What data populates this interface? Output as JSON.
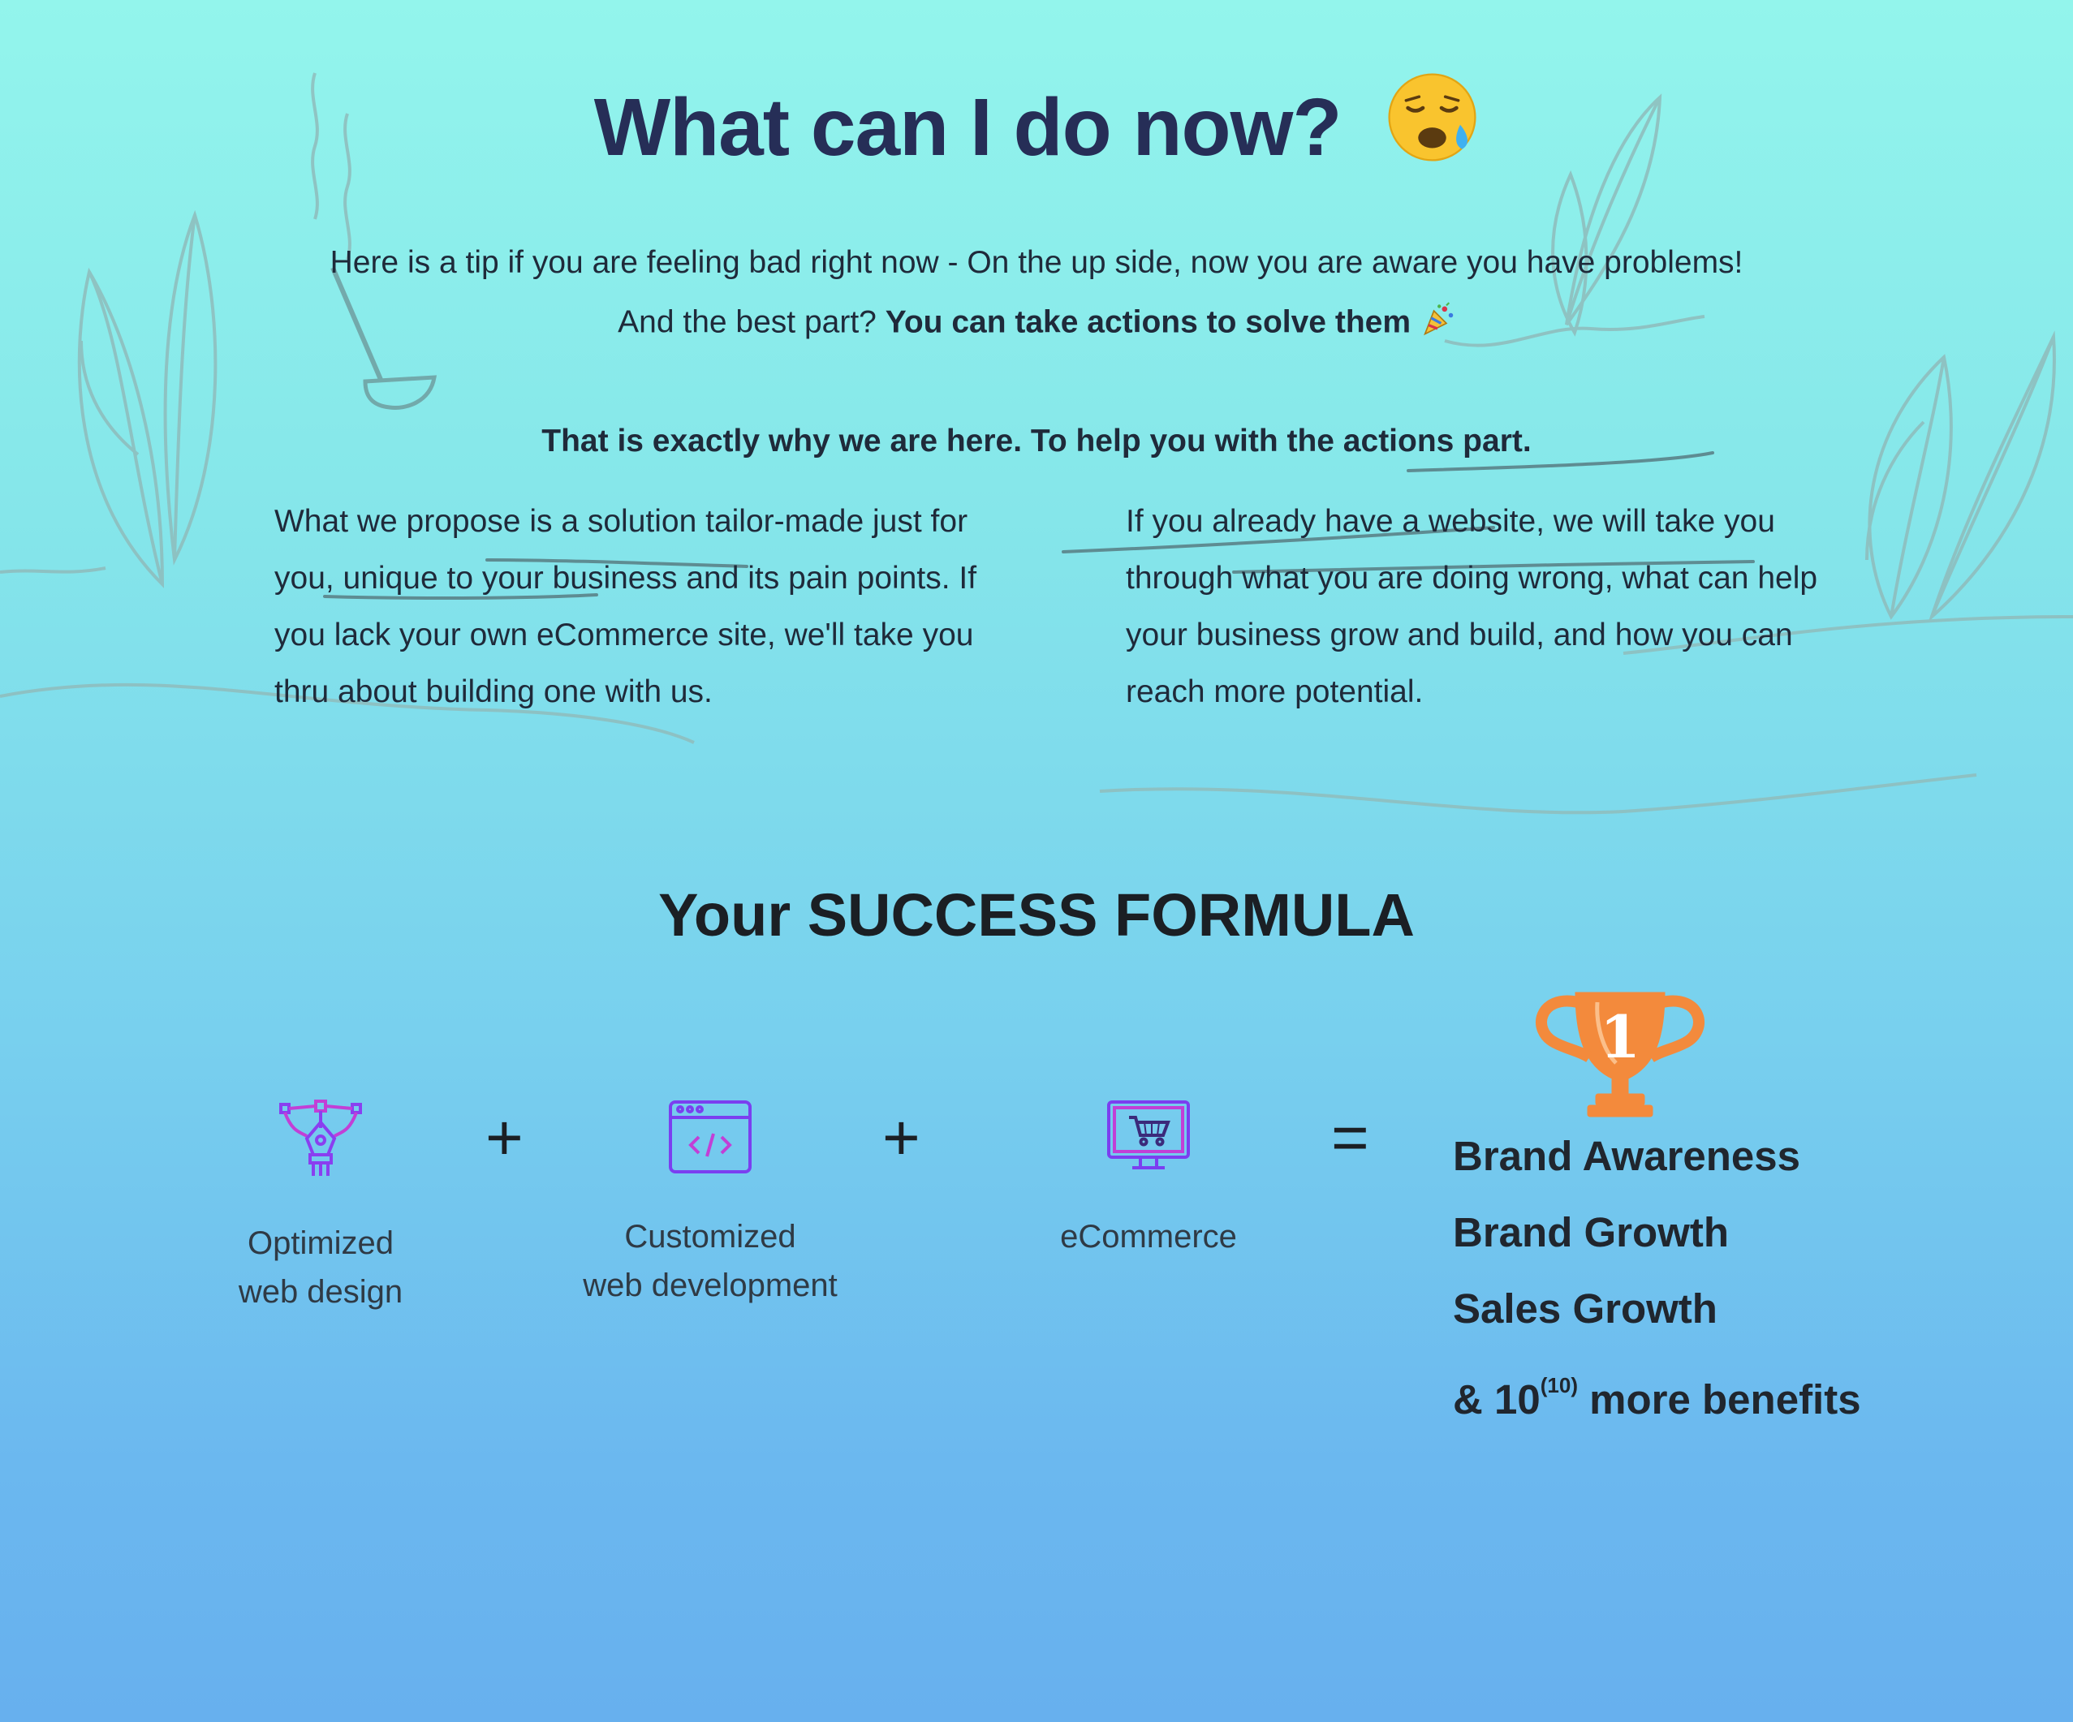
{
  "heading": {
    "title": "What can I do now?",
    "title_emoji": "sad-face-emoji"
  },
  "intro": {
    "line1": "Here is a tip if you are feeling bad right now - On the up side, now you are aware you have problems!",
    "line2_prefix": "And the best part?",
    "line2_bold": "You can take actions to solve them",
    "line2_emoji": "party-popper-icon",
    "line3": "That is exactly why we are here. To help you with the actions part."
  },
  "paragraphs": {
    "left": "What we propose is a solution tailor-made just for you, unique to your business and its pain points.  If you lack your own eCommerce site, we'll take you thru about building one with us.",
    "right": "If you already have a website, we will take you through what you are doing wrong, what can help your business grow and build, and how you can reach more potential."
  },
  "formula": {
    "title": "Your SUCCESS FORMULA",
    "items": [
      {
        "line1": "Optimized",
        "line2": "web design",
        "icon": "pen-tool-icon"
      },
      {
        "line1": "Customized",
        "line2": "web development",
        "icon": "code-window-icon"
      },
      {
        "line1": "eCommerce",
        "line2": "",
        "icon": "monitor-cart-icon"
      }
    ],
    "plus": "+",
    "equals": "=",
    "trophy_icon": "trophy-icon",
    "trophy_number": "1",
    "benefits": [
      "Brand Awareness",
      "Brand Growth",
      "Sales Growth"
    ],
    "benefit_last": {
      "prefix": "& 10",
      "superscript": "(10)",
      "suffix": " more benefits"
    }
  },
  "colors": {
    "heading": "#262e57",
    "icon_purple": "#8a3ff0",
    "trophy_orange": "#f38a3c",
    "sketch_lines": "#8fb8b8"
  }
}
